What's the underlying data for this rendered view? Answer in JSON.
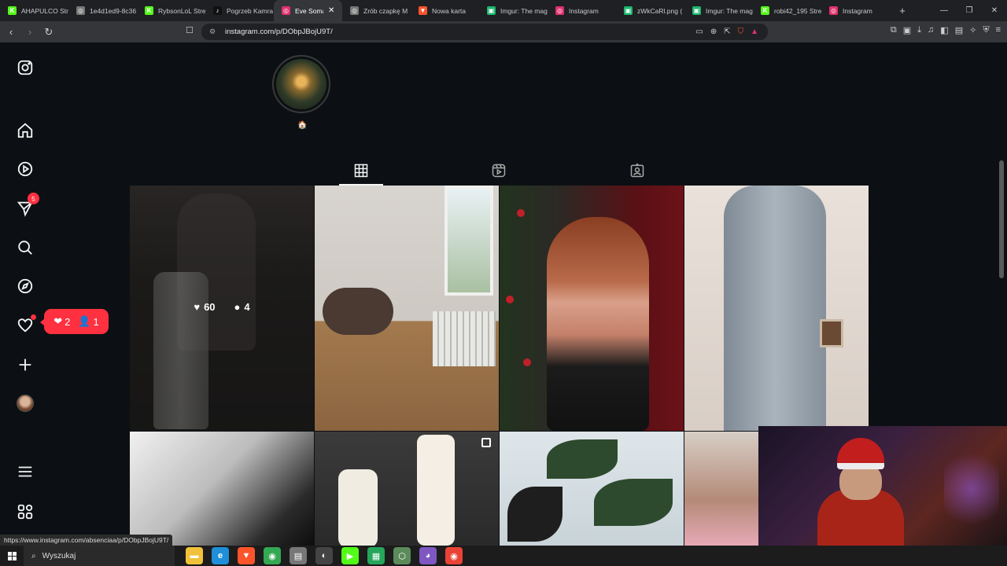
{
  "browser": {
    "tabs": [
      {
        "label": "AHAPULCO Stre",
        "icon": "kick-icon",
        "color": "#53fc18",
        "glyph": "K",
        "active": false
      },
      {
        "label": "1e4d1ed9-8c36",
        "icon": "globe-icon",
        "color": "#777777",
        "glyph": "◎",
        "active": false
      },
      {
        "label": "RybsonLoL Stre",
        "icon": "kick-icon",
        "color": "#53fc18",
        "glyph": "K",
        "active": false
      },
      {
        "label": "Pogrzeb Kamra",
        "icon": "tiktok-icon",
        "color": "#111111",
        "glyph": "♪",
        "active": false
      },
      {
        "label": "Eve Somas",
        "icon": "instagram-icon",
        "color": "#e1306c",
        "glyph": "◎",
        "active": true
      },
      {
        "label": "Zrób czapkę M",
        "icon": "globe-icon",
        "color": "#777777",
        "glyph": "◎",
        "active": false
      },
      {
        "label": "Nowa karta",
        "icon": "brave-icon",
        "color": "#fb542b",
        "glyph": "▼",
        "active": false
      },
      {
        "label": "Imgur: The mag",
        "icon": "imgur-icon",
        "color": "#1bb76e",
        "glyph": "▣",
        "active": false
      },
      {
        "label": "Instagram",
        "icon": "instagram-icon",
        "color": "#e1306c",
        "glyph": "◎",
        "active": false
      },
      {
        "label": "zWkCaRl.png (",
        "icon": "imgur-icon",
        "color": "#1bb76e",
        "glyph": "▣",
        "active": false
      },
      {
        "label": "Imgur: The mag",
        "icon": "imgur-icon",
        "color": "#1bb76e",
        "glyph": "▣",
        "active": false
      },
      {
        "label": "robi42_195 Stre",
        "icon": "kick-icon",
        "color": "#53fc18",
        "glyph": "K",
        "active": false
      },
      {
        "label": "Instagram",
        "icon": "instagram-icon",
        "color": "#e1306c",
        "glyph": "◎",
        "active": false
      }
    ],
    "new_tab": "+",
    "close_glyph": "✕",
    "url": "instagram.com/p/DObpJBojU9T/",
    "window": {
      "minimize": "—",
      "restore": "❐",
      "close": "✕"
    }
  },
  "sidebar": {
    "messages_badge": "5"
  },
  "notifications_popup": {
    "likes": "2",
    "follows": "1"
  },
  "profile": {
    "house_emoji": "🏠"
  },
  "hover_post": {
    "likes": "60",
    "comments": "4"
  },
  "status_link": "https://www.instagram.com/absenciaa/p/DObpJBojU9T/",
  "taskbar": {
    "search_placeholder": "Wyszukaj",
    "apps": [
      {
        "name": "file-explorer-icon",
        "color": "#f0c23b",
        "glyph": "▬"
      },
      {
        "name": "edge-icon",
        "color": "#1e8fd8",
        "glyph": "e"
      },
      {
        "name": "brave-icon",
        "color": "#fb542b",
        "glyph": "▼"
      },
      {
        "name": "chrome-icon",
        "color": "#34a853",
        "glyph": "◉"
      },
      {
        "name": "app-icon",
        "color": "#777777",
        "glyph": "▤"
      },
      {
        "name": "obs-icon",
        "color": "#444444",
        "glyph": "◐"
      },
      {
        "name": "kick-icon",
        "color": "#53fc18",
        "glyph": "▶"
      },
      {
        "name": "app-icon-2",
        "color": "#26a65b",
        "glyph": "▦"
      },
      {
        "name": "app-icon-3",
        "color": "#5b8a5b",
        "glyph": "⬡"
      },
      {
        "name": "discord-icon",
        "color": "#7e57c2",
        "glyph": "◕"
      },
      {
        "name": "chrome-icon-2",
        "color": "#ea4335",
        "glyph": "◉"
      }
    ]
  }
}
